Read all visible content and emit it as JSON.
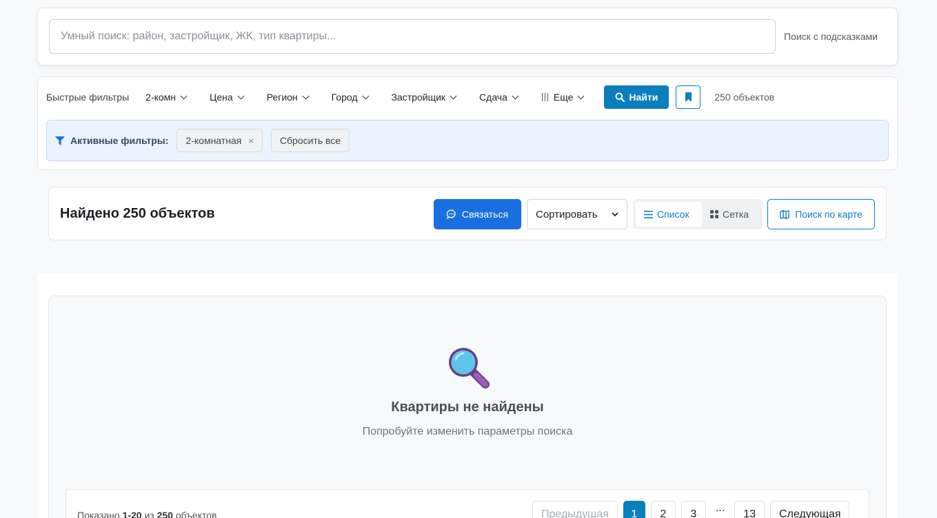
{
  "search": {
    "placeholder": "Умный поиск: район, застройщик, ЖК, тип квартиры...",
    "hint": "Поиск с подсказками"
  },
  "filters": {
    "label": "Быстрые фильтры",
    "dropdowns": [
      "2-комн",
      "Цена",
      "Регион",
      "Город",
      "Застройщик",
      "Сдача"
    ],
    "more_label": "Еще",
    "find_button": "Найти",
    "count": "250 объектов",
    "active_label": "Активные фильтры:",
    "active_chips": [
      "2-комнатная"
    ],
    "chip_remove": "×",
    "reset_label": "Сбросить все"
  },
  "results": {
    "title": "Найдено 250 объектов",
    "contact_button": "Связаться",
    "sort_label": "Сортировать",
    "view_list": "Список",
    "view_grid": "Сетка",
    "map_button": "Поиск по карте"
  },
  "empty": {
    "title": "Квартиры не найдены",
    "subtitle": "Попробуйте изменить параметры поиска"
  },
  "pagination": {
    "info_prefix": "Показано",
    "range": "1-20",
    "of": "из",
    "total": "250",
    "suffix": "объектов",
    "prev": "Предыдущая",
    "pages": [
      "1",
      "2",
      "3"
    ],
    "dots": "...",
    "last": "13",
    "next": "Следующая"
  },
  "colors": {
    "primary": "#0a7fbd",
    "contact": "#1a6fe0",
    "active_bar": "#eaf3fe"
  }
}
